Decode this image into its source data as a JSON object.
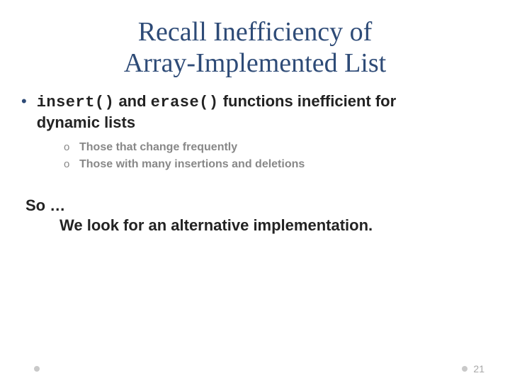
{
  "title_line1": "Recall Inefficiency of",
  "title_line2": "Array-Implemented List",
  "bullet": {
    "code1": "insert()",
    "mid": " and ",
    "code2": "erase()",
    "tail1": " functions inefficient for",
    "tail2": "dynamic lists"
  },
  "sub": [
    "Those that change frequently",
    "Those with many insertions and deletions"
  ],
  "so_label": "So  …",
  "so_body": "We look for an alternative implementation.",
  "page_number": "21"
}
